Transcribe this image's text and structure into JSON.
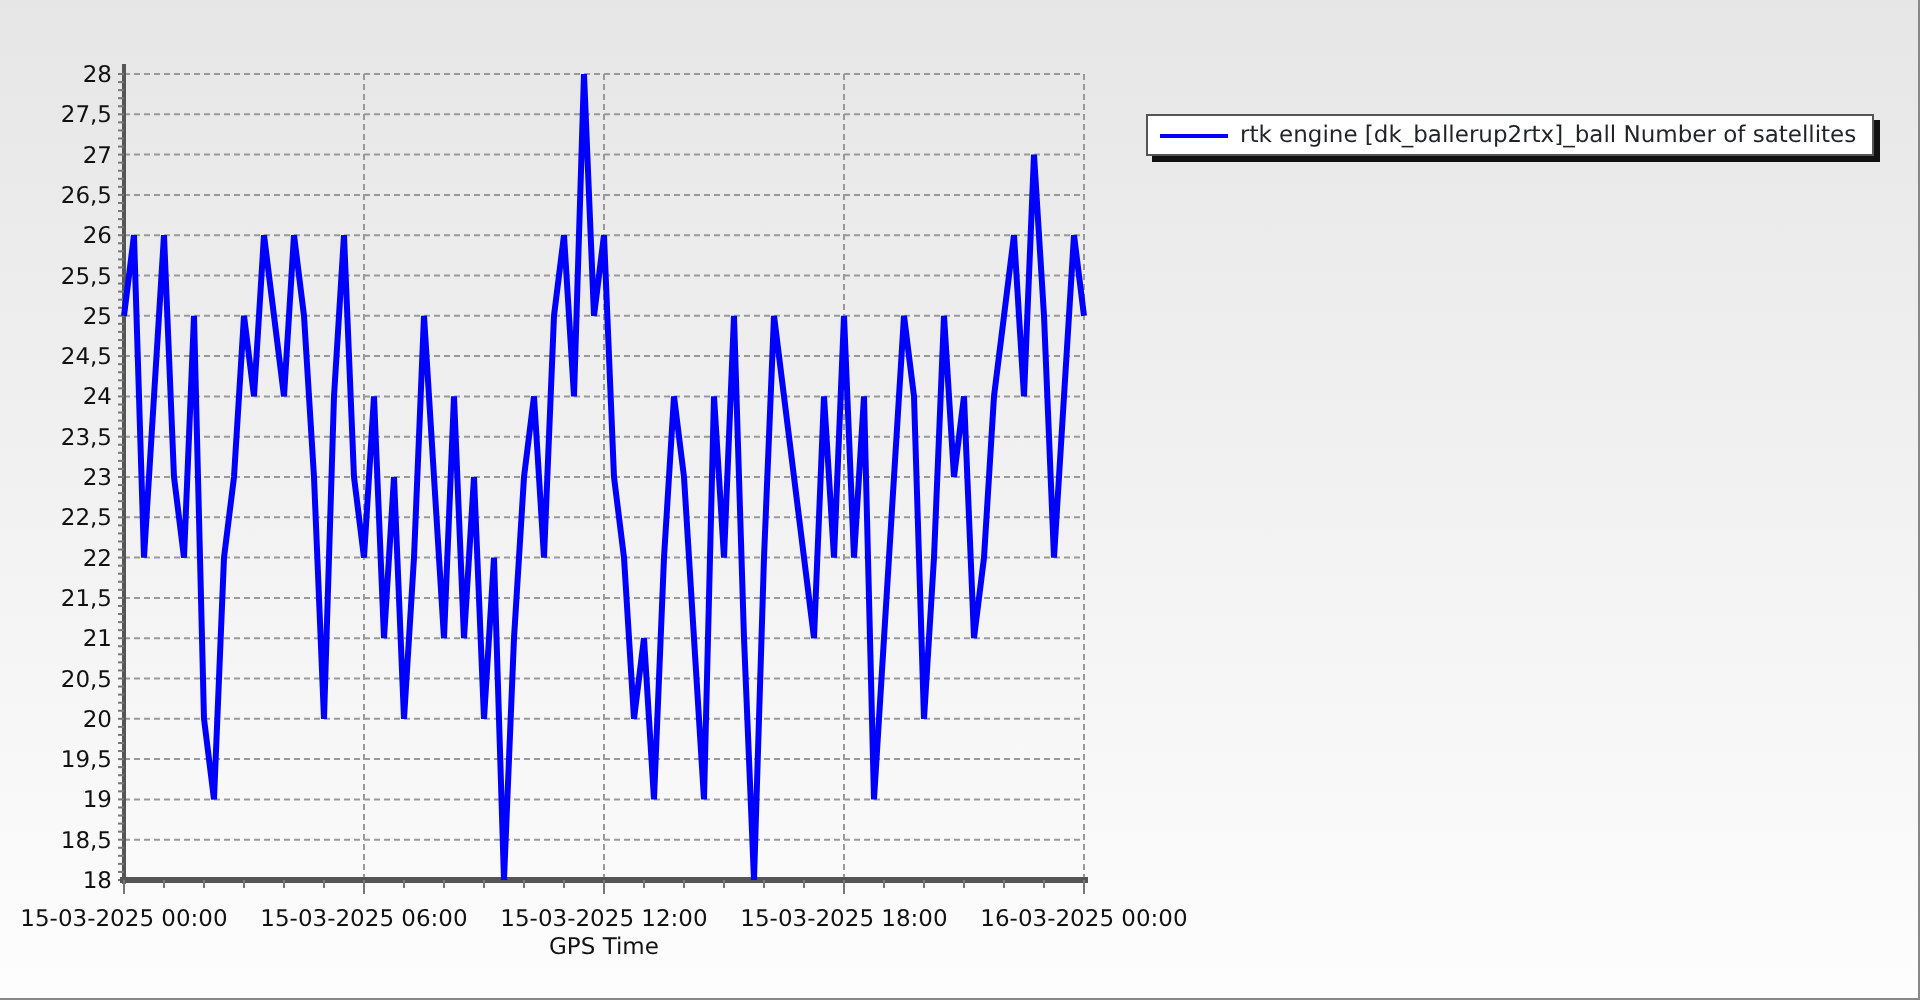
{
  "chart": {
    "chart_data": {
      "type": "line",
      "grid": true,
      "xlabel": "GPS Time",
      "categories": [
        "15-03-2025 00:00",
        null,
        null,
        null,
        null,
        null,
        null,
        null,
        null,
        null,
        null,
        null,
        null,
        null,
        null,
        null,
        null,
        null,
        null,
        null,
        null,
        null,
        null,
        null,
        "15-03-2025 06:00",
        null,
        null,
        null,
        null,
        null,
        null,
        null,
        null,
        null,
        null,
        null,
        null,
        null,
        null,
        null,
        null,
        null,
        null,
        null,
        null,
        null,
        null,
        null,
        "15-03-2025 12:00",
        null,
        null,
        null,
        null,
        null,
        null,
        null,
        null,
        null,
        null,
        null,
        null,
        null,
        null,
        null,
        null,
        null,
        null,
        null,
        null,
        null,
        null,
        null,
        "15-03-2025 18:00",
        null,
        null,
        null,
        null,
        null,
        null,
        null,
        null,
        null,
        null,
        null,
        null,
        null,
        null,
        null,
        null,
        null,
        null,
        null,
        null,
        null,
        null,
        null,
        "16-03-2025 00:00"
      ],
      "series": [
        {
          "name": "rtk engine [dk_ballerup2rtx]_ball Number of satellites",
          "color": "#0000ff",
          "values": [
            25,
            26,
            22,
            24,
            26,
            23,
            22,
            25,
            20,
            19,
            22,
            23,
            25,
            24,
            26,
            25,
            24,
            26,
            25,
            23,
            20,
            24,
            26,
            23,
            22,
            24,
            21,
            23,
            20,
            22,
            25,
            23,
            21,
            24,
            21,
            23,
            20,
            22,
            18,
            21,
            23,
            24,
            22,
            25,
            26,
            24,
            28,
            25,
            26,
            23,
            22,
            20,
            21,
            19,
            22,
            24,
            23,
            21,
            19,
            24,
            22,
            25,
            21,
            18,
            22,
            25,
            24,
            23,
            22,
            21,
            24,
            22,
            25,
            22,
            24,
            19,
            21,
            23,
            25,
            24,
            20,
            22,
            25,
            23,
            24,
            21,
            22,
            24,
            25,
            26,
            24,
            27,
            25,
            22,
            24,
            26,
            25
          ]
        }
      ],
      "ylim": [
        18,
        28
      ],
      "yticks": [
        18,
        {
          "value": 18.5,
          "label": "18,5"
        },
        19,
        {
          "value": 19.5,
          "label": "19,5"
        },
        20,
        {
          "value": 20.5,
          "label": "20,5"
        },
        21,
        {
          "value": 21.5,
          "label": "21,5"
        },
        22,
        {
          "value": 22.5,
          "label": "22,5"
        },
        23,
        {
          "value": 23.5,
          "label": "23,5"
        },
        24,
        {
          "value": 24.5,
          "label": "24,5"
        },
        25,
        {
          "value": 25.5,
          "label": "25,5"
        },
        26,
        {
          "value": 26.5,
          "label": "26,5"
        },
        27,
        {
          "value": 27.5,
          "label": "27,5"
        },
        28
      ]
    }
  }
}
